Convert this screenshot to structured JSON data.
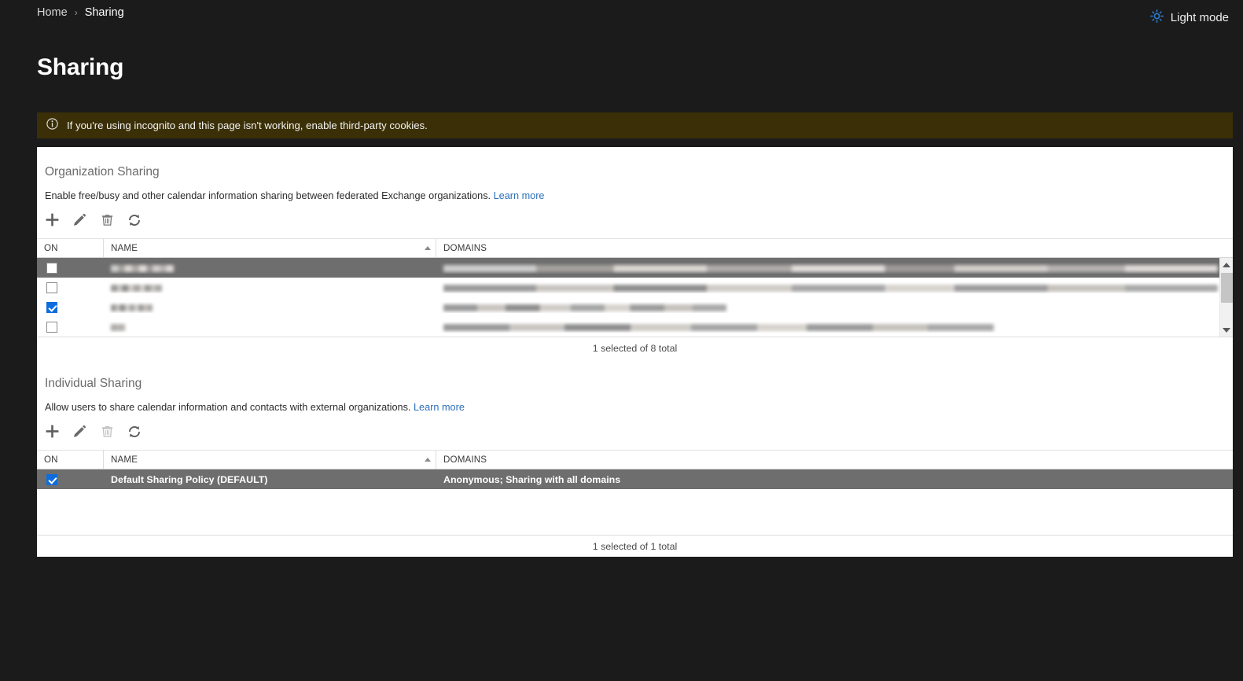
{
  "topbar": {
    "breadcrumb": {
      "home": "Home",
      "separator": "›",
      "current": "Sharing"
    },
    "light_mode": {
      "label": "Light mode",
      "icon": "sun-icon",
      "color": "#2f7fd6"
    }
  },
  "page_title": "Sharing",
  "banner": {
    "icon": "info-circle-icon",
    "text": "If you're using  incognito and this page isn't working, enable third-party cookies.",
    "background": "#3b2f07"
  },
  "toolbar": {
    "add_label": "+",
    "edit_label": "edit-pencil",
    "delete_label": "delete-trash",
    "refresh_label": "refresh"
  },
  "columns": {
    "on": "ON",
    "name": "NAME",
    "domains": "DOMAINS",
    "sort": "ascending"
  },
  "organization_sharing": {
    "title": "Organization Sharing",
    "description": "Enable free/busy and other calendar information sharing between federated Exchange organizations.",
    "learn_more": "Learn more",
    "rows": [
      {
        "on": false,
        "name": "",
        "domains": "",
        "state": "highlight",
        "redacted": true,
        "name_width": 80,
        "domains_width": 985
      },
      {
        "on": false,
        "name": "",
        "domains": "",
        "state": "normal",
        "redacted": true,
        "name_width": 65,
        "domains_width": 985
      },
      {
        "on": true,
        "name": "",
        "domains": "",
        "state": "normal",
        "redacted": true,
        "name_width": 53,
        "domains_width": 360
      },
      {
        "on": false,
        "name": "",
        "domains": "",
        "state": "normal",
        "redacted": true,
        "name_width": 18,
        "domains_width": 700
      }
    ],
    "footer": "1 selected of 8 total"
  },
  "individual_sharing": {
    "title": "Individual Sharing",
    "description": "Allow users to share calendar information and contacts with external organizations.",
    "learn_more": "Learn more",
    "rows": [
      {
        "on": true,
        "name": "Default Sharing Policy (DEFAULT)",
        "domains": "Anonymous; Sharing with all domains",
        "state": "selected",
        "redacted": false
      }
    ],
    "footer": "1 selected of 1 total"
  }
}
